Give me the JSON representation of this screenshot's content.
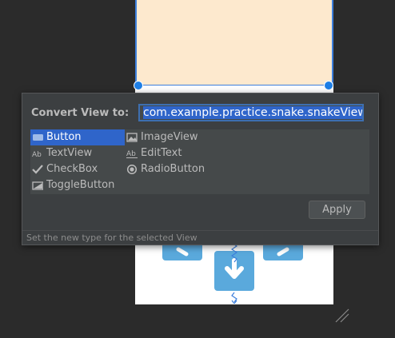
{
  "dialog": {
    "label": "Convert View to:",
    "input_value": "com.example.practice.snake.snakeView",
    "items": [
      {
        "label": "Button",
        "icon": "button-icon",
        "selected": true
      },
      {
        "label": "ImageView",
        "icon": "image-icon"
      },
      {
        "label": "TextView",
        "icon": "text-icon"
      },
      {
        "label": "EditText",
        "icon": "edittext-icon"
      },
      {
        "label": "CheckBox",
        "icon": "checkmark-icon"
      },
      {
        "label": "RadioButton",
        "icon": "radio-icon"
      },
      {
        "label": "ToggleButton",
        "icon": "toggle-icon"
      }
    ],
    "apply_label": "Apply",
    "status_text": "Set the new type for the selected View"
  },
  "colors": {
    "selection": "#2f65ca",
    "dialog_bg": "#3c3f41",
    "preview_top": "#fde9ce",
    "tile": "#5aa9dc"
  }
}
